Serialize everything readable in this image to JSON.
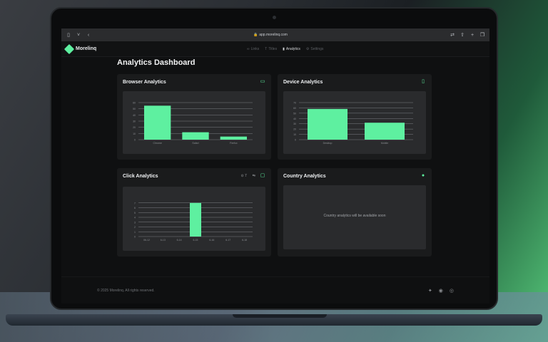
{
  "browser": {
    "url": "app.morelinq.com",
    "lock_icon": "lock-icon"
  },
  "brand": {
    "name": "Morelinq",
    "color": "#5ef0a0"
  },
  "nav": {
    "items": [
      {
        "label": "Links",
        "icon": "link-icon",
        "active": false
      },
      {
        "label": "Titles",
        "icon": "title-icon",
        "active": false
      },
      {
        "label": "Analytics",
        "icon": "chart-icon",
        "active": true
      },
      {
        "label": "Settings",
        "icon": "gear-icon",
        "active": false
      }
    ]
  },
  "page": {
    "title": "Analytics Dashboard"
  },
  "cards": {
    "browser": {
      "title": "Browser Analytics",
      "icon": "browser-icon"
    },
    "device": {
      "title": "Device Analytics",
      "icon": "mobile-icon"
    },
    "click": {
      "title": "Click Analytics",
      "icon": "mouse-icon",
      "tool_a": "⊙ 7",
      "tool_b": "⇆"
    },
    "country": {
      "title": "Country Analytics",
      "icon": "globe-icon",
      "placeholder": "Country analytics will be available soon"
    }
  },
  "chart_data": [
    {
      "type": "bar",
      "title": "Browser Analytics",
      "categories": [
        "Chrome",
        "Safari",
        "Firefox"
      ],
      "values": [
        55,
        12,
        5
      ],
      "ylim": [
        0,
        60
      ],
      "yticks": [
        0,
        10,
        20,
        30,
        40,
        50,
        60
      ],
      "grid": true
    },
    {
      "type": "bar",
      "title": "Device Analytics",
      "categories": [
        "Desktop",
        "Mobile"
      ],
      "values": [
        58,
        32
      ],
      "ylim": [
        0,
        70
      ],
      "yticks": [
        0,
        10,
        20,
        30,
        40,
        50,
        60,
        70
      ],
      "grid": true
    },
    {
      "type": "bar",
      "title": "Click Analytics",
      "categories": [
        "06-12",
        "6-13",
        "6-14",
        "6-15",
        "6-16",
        "6-17",
        "6-18"
      ],
      "values": [
        0,
        0,
        0,
        7,
        0,
        0,
        0
      ],
      "ylim": [
        0,
        8
      ],
      "yticks": [
        0,
        1,
        2,
        3,
        4,
        5,
        6,
        7
      ],
      "grid": true
    }
  ],
  "footer": {
    "copyright": "© 2025 Morelinq. All rights reserved.",
    "social": [
      "twitter-icon",
      "github-icon",
      "instagram-icon"
    ]
  }
}
